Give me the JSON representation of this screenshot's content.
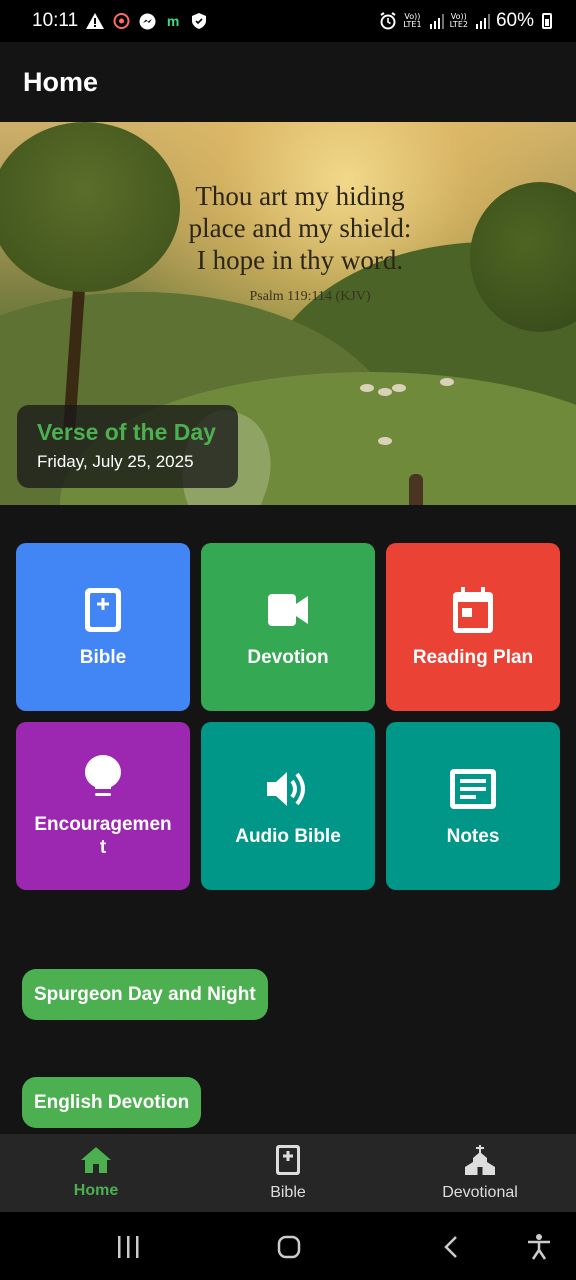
{
  "status_bar": {
    "time": "10:11",
    "left_icons": [
      "warning-icon",
      "chat-icon",
      "messenger-icon",
      "m-app-icon",
      "shield-icon"
    ],
    "right_icons": [
      "alarm-icon",
      "signal-lte1-icon",
      "signal-lte2-icon",
      "battery-icon"
    ],
    "lte1": "Vo)) LTE1",
    "lte2": "Vo)) LTE2",
    "battery": "60%"
  },
  "app_bar": {
    "title": "Home"
  },
  "hero": {
    "verse_lines": [
      "Thou art my hiding",
      "place and my shield:",
      "I hope in thy word."
    ],
    "reference": "Psalm 119:114 (KJV)"
  },
  "votd": {
    "title": "Verse of the Day",
    "date": "Friday, July 25, 2025"
  },
  "tiles": [
    {
      "label": "Bible",
      "icon": "bible-icon",
      "color": "#4285f4"
    },
    {
      "label": "Devotion",
      "icon": "video-icon",
      "color": "#34a853"
    },
    {
      "label": "Reading Plan",
      "icon": "calendar-icon",
      "color": "#ea4335"
    },
    {
      "label": "Encouragement",
      "icon": "lightbulb-icon",
      "color": "#9c27b0"
    },
    {
      "label": "Audio Bible",
      "icon": "speaker-icon",
      "color": "#009688"
    },
    {
      "label": "Notes",
      "icon": "notes-icon",
      "color": "#009688"
    }
  ],
  "pills": [
    {
      "label": "Spurgeon Day and Night"
    },
    {
      "label": "English Devotion"
    }
  ],
  "bottom_nav": [
    {
      "label": "Home",
      "icon": "home-icon",
      "active": true
    },
    {
      "label": "Bible",
      "icon": "bible-icon",
      "active": false
    },
    {
      "label": "Devotional",
      "icon": "church-icon",
      "active": false
    }
  ],
  "colors": {
    "accent": "#4caf50",
    "background": "#141414",
    "nav_background": "#262626"
  }
}
